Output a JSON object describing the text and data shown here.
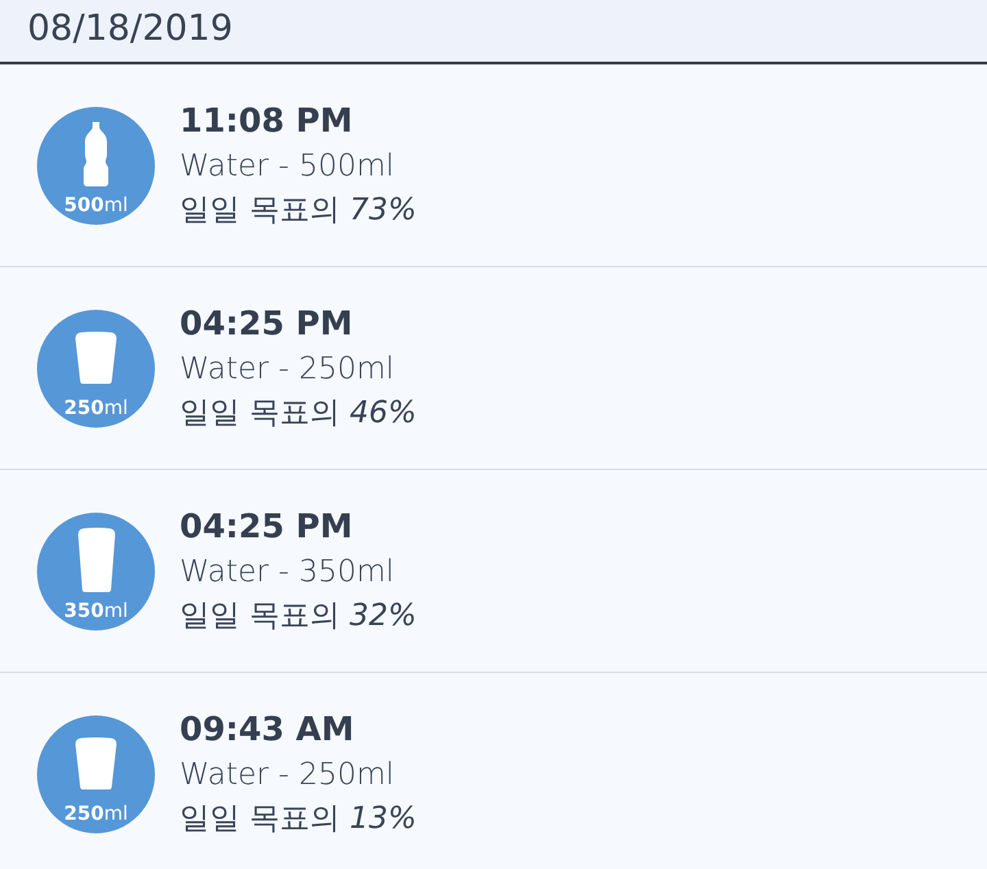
{
  "header": {
    "date": "08/18/2019"
  },
  "entries": [
    {
      "kind": "bottle",
      "badge_label": "**500**ml",
      "time": "11:08 PM",
      "description": "Water - 500ml",
      "goal": "일일 목표의 *73%*"
    },
    {
      "kind": "cup",
      "badge_label": "**250**ml",
      "time": "04:25 PM",
      "description": "Water - 250ml",
      "goal": "일일 목표의 *46%*"
    },
    {
      "kind": "tall_cup",
      "badge_label": "**350**ml",
      "time": "04:25 PM",
      "description": "Water - 350ml",
      "goal": "일일 목표의 *32%*"
    },
    {
      "kind": "cup",
      "badge_label": "**250**ml",
      "time": "09:43 AM",
      "description": "Water - 250ml",
      "goal": "일일 목표의 *13%*"
    }
  ]
}
